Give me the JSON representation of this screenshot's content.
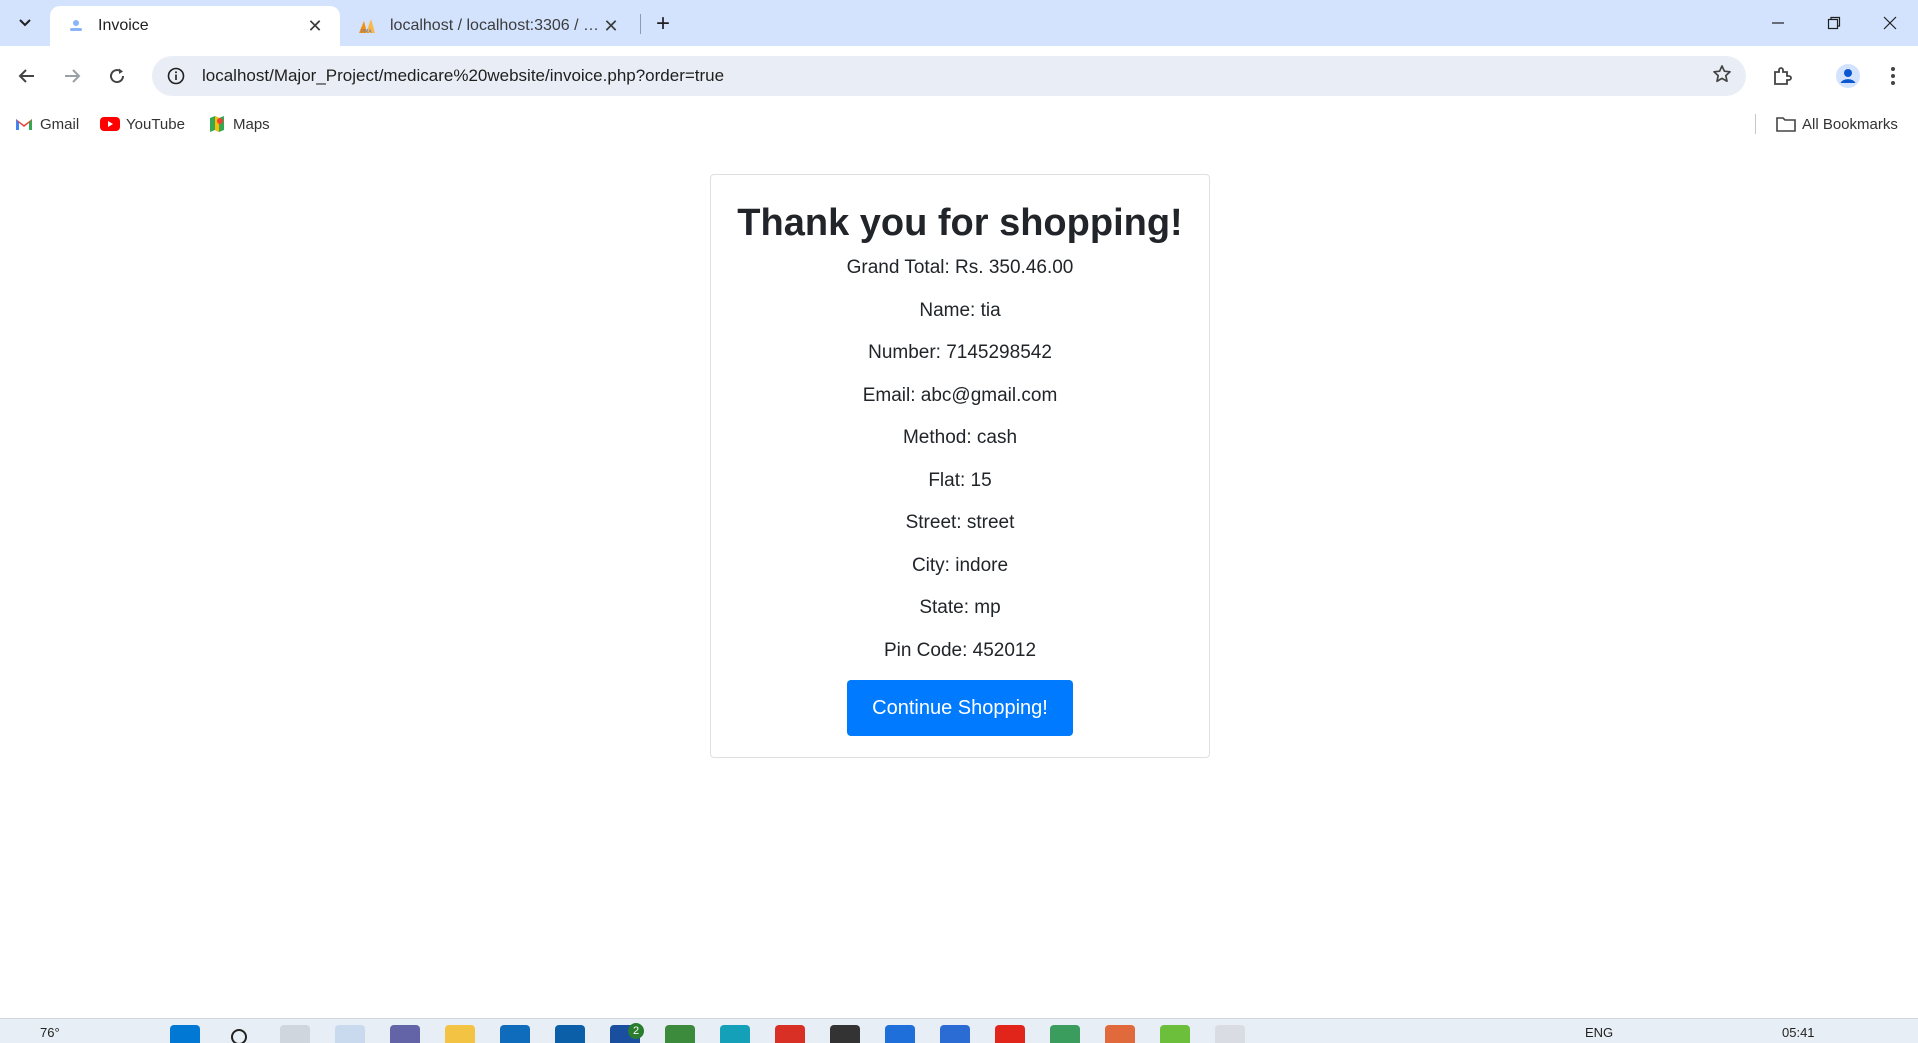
{
  "browser": {
    "tabs": [
      {
        "title": "Invoice",
        "active": true
      },
      {
        "title": "localhost / localhost:3306 / pha",
        "active": false
      }
    ],
    "url": "localhost/Major_Project/medicare%20website/invoice.php?order=true",
    "bookmarks": [
      "Gmail",
      "YouTube",
      "Maps"
    ],
    "all_bookmarks_label": "All Bookmarks"
  },
  "invoice": {
    "heading": "Thank you for shopping!",
    "grand_total": "Grand Total: Rs. 350.46.00",
    "name": "Name: tia",
    "number": "Number: 7145298542",
    "email": "Email: abc@gmail.com",
    "method": "Method: cash",
    "flat": "Flat: 15",
    "street": "Street: street",
    "city": "City: indore",
    "state": "State: mp",
    "pin_code": "Pin Code: 452012",
    "button_label": "Continue Shopping!"
  },
  "taskbar": {
    "weather": "76°",
    "language": "ENG",
    "time": "05:41",
    "badge_count": "2"
  },
  "colors": {
    "primary_button": "#007bff",
    "tabbar": "#d3e3fd",
    "omnibox": "#e9eef6"
  }
}
